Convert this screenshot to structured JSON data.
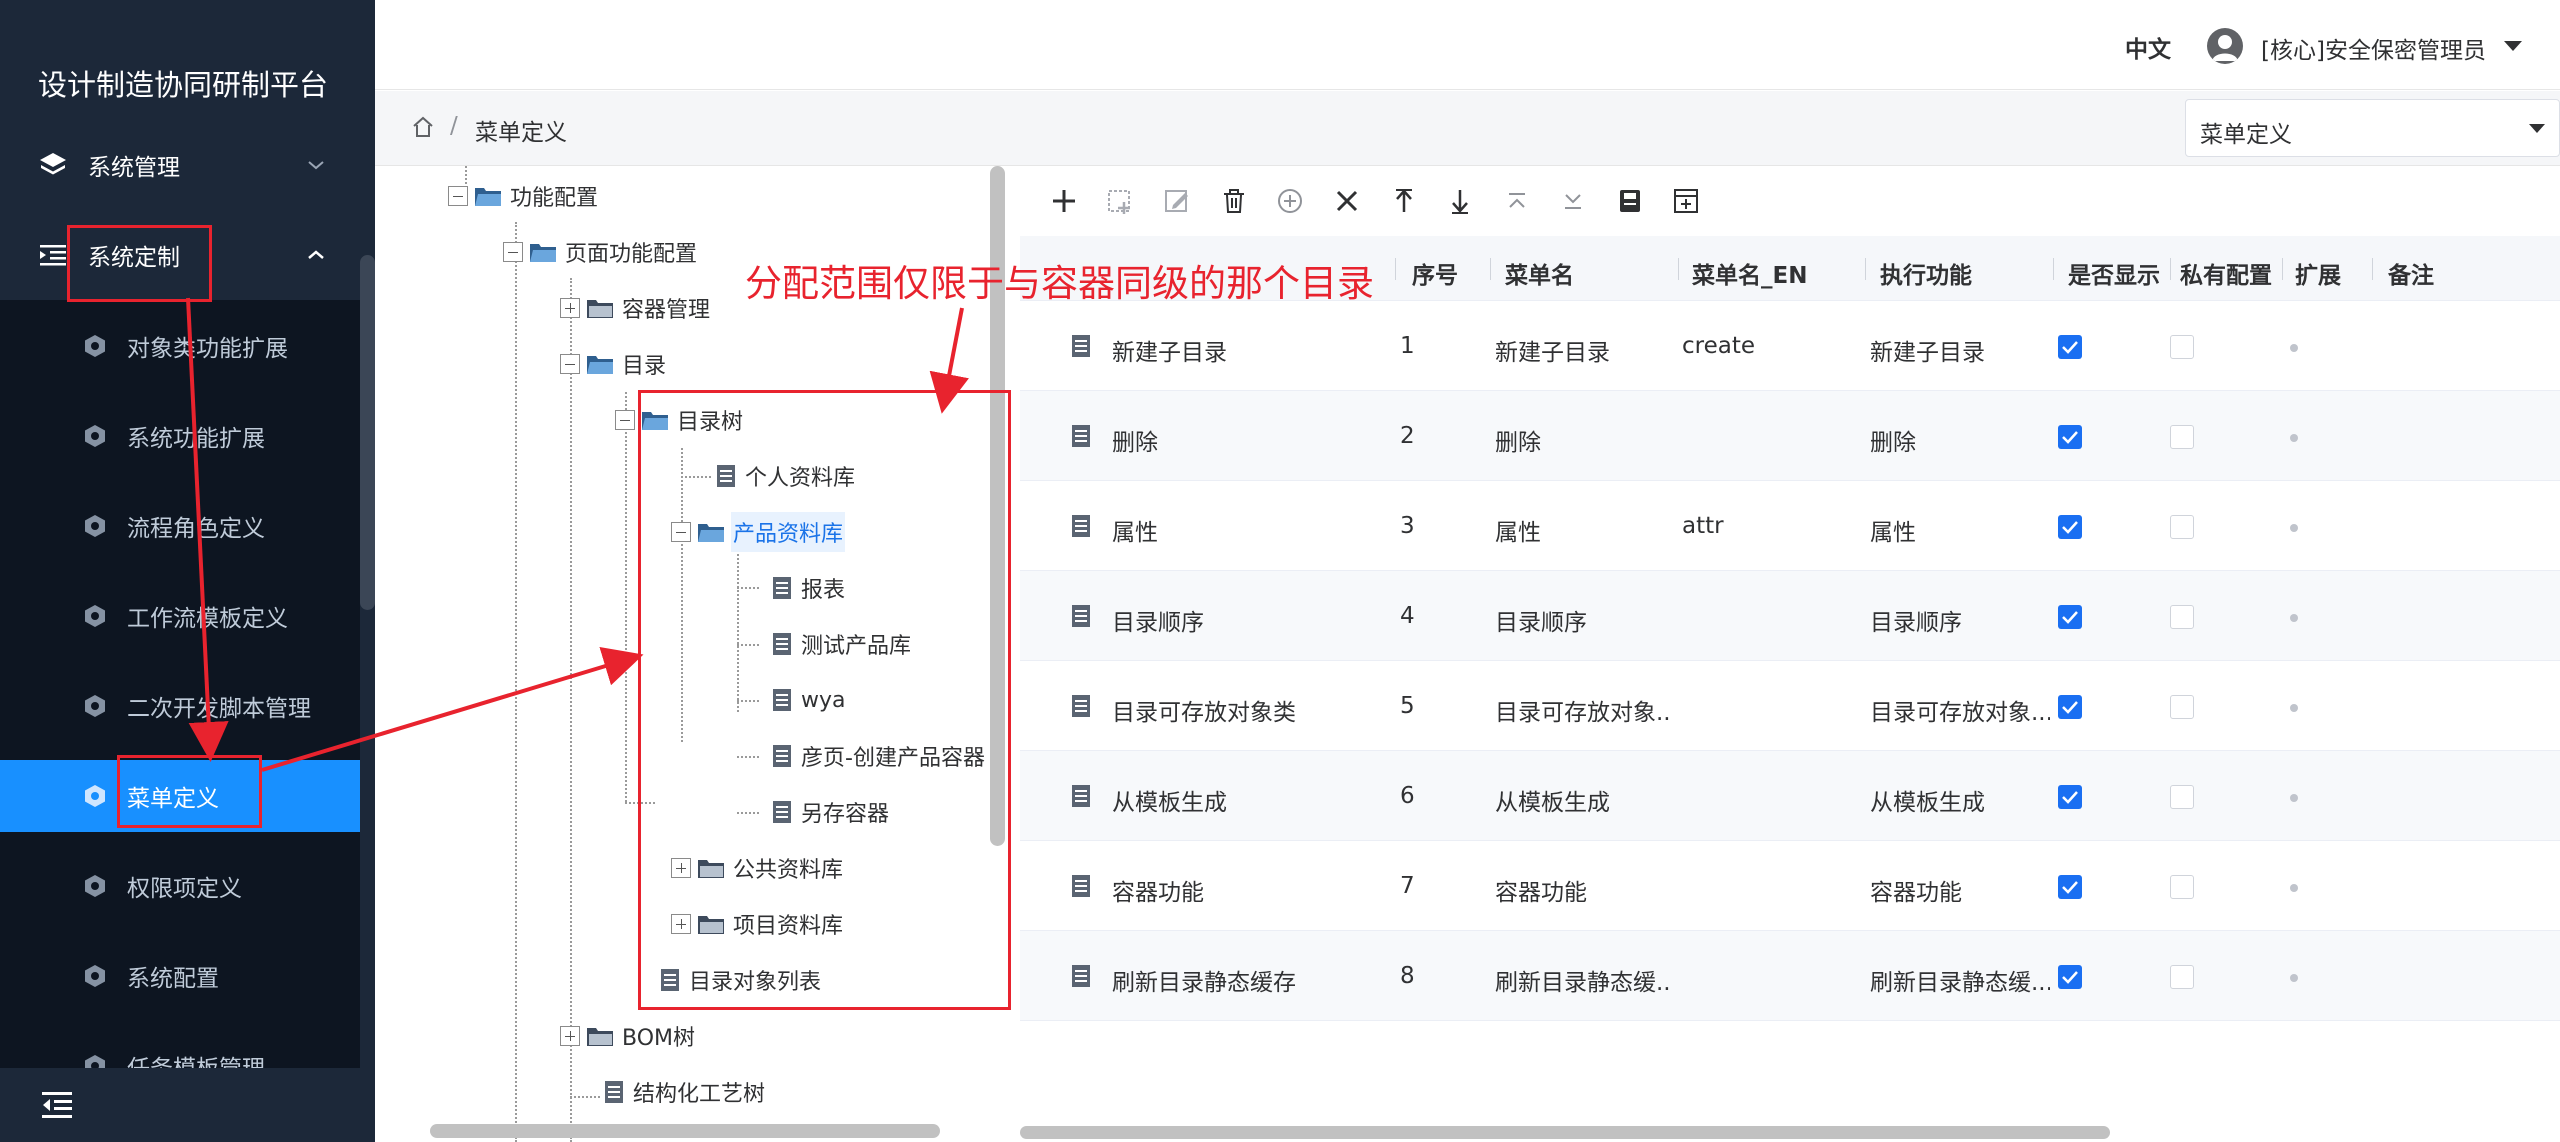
{
  "app": {
    "title": "设计制造协同研制平台"
  },
  "sidebar": {
    "groups": [
      {
        "label": "系统管理"
      },
      {
        "label": "系统定制"
      }
    ],
    "items": [
      {
        "label": "对象类功能扩展"
      },
      {
        "label": "系统功能扩展"
      },
      {
        "label": "流程角色定义"
      },
      {
        "label": "工作流模板定义"
      },
      {
        "label": "二次开发脚本管理"
      },
      {
        "label": "菜单定义"
      },
      {
        "label": "权限项定义"
      },
      {
        "label": "系统配置"
      },
      {
        "label": "任务模板管理"
      }
    ],
    "active_item": "菜单定义"
  },
  "header": {
    "language": "中文",
    "user": "[核心]安全保密管理员"
  },
  "breadcrumb": {
    "separator": "/",
    "current": "菜单定义"
  },
  "menu_select": {
    "value": "菜单定义"
  },
  "tree": {
    "nodes": [
      {
        "label": "功能配置"
      },
      {
        "label": "页面功能配置"
      },
      {
        "label": "容器管理"
      },
      {
        "label": "目录"
      },
      {
        "label": "目录树"
      },
      {
        "label": "个人资料库"
      },
      {
        "label": "产品资料库"
      },
      {
        "label": "报表"
      },
      {
        "label": "测试产品库"
      },
      {
        "label": "wya"
      },
      {
        "label": "彦页-创建产品容器"
      },
      {
        "label": "另存容器"
      },
      {
        "label": "公共资料库"
      },
      {
        "label": "项目资料库"
      },
      {
        "label": "目录对象列表"
      },
      {
        "label": "BOM树"
      },
      {
        "label": "结构化工艺树"
      }
    ]
  },
  "toolbar": {
    "buttons": [
      {
        "icon": "plus-icon"
      },
      {
        "icon": "add-child-icon"
      },
      {
        "icon": "edit-icon"
      },
      {
        "icon": "delete-icon"
      },
      {
        "icon": "circle-plus-icon"
      },
      {
        "icon": "close-icon"
      },
      {
        "icon": "move-up-icon"
      },
      {
        "icon": "move-down-icon"
      },
      {
        "icon": "move-top-icon"
      },
      {
        "icon": "move-bottom-icon"
      },
      {
        "icon": "save-icon"
      },
      {
        "icon": "import-icon"
      }
    ]
  },
  "grid": {
    "columns": [
      "序号",
      "菜单名",
      "菜单名_EN",
      "执行功能",
      "是否显示",
      "私有配置",
      "扩展",
      "备注"
    ],
    "rows": [
      {
        "name": "新建子目录",
        "seq": "1",
        "menu": "新建子目录",
        "en": "create",
        "func": "新建子目录",
        "show": true
      },
      {
        "name": "删除",
        "seq": "2",
        "menu": "删除",
        "en": "",
        "func": "删除",
        "show": true
      },
      {
        "name": "属性",
        "seq": "3",
        "menu": "属性",
        "en": "attr",
        "func": "属性",
        "show": true
      },
      {
        "name": "目录顺序",
        "seq": "4",
        "menu": "目录顺序",
        "en": "",
        "func": "目录顺序",
        "show": true
      },
      {
        "name": "目录可存放对象类",
        "seq": "5",
        "menu": "目录可存放对象...",
        "en": "",
        "func": "目录可存放对象...",
        "show": true
      },
      {
        "name": "从模板生成",
        "seq": "6",
        "menu": "从模板生成",
        "en": "",
        "func": "从模板生成",
        "show": true
      },
      {
        "name": "容器功能",
        "seq": "7",
        "menu": "容器功能",
        "en": "",
        "func": "容器功能",
        "show": true
      },
      {
        "name": "刷新目录静态缓存",
        "seq": "8",
        "menu": "刷新目录静态缓...",
        "en": "",
        "func": "刷新目录静态缓...",
        "show": true
      }
    ]
  },
  "annotation": {
    "text": "分配范围仅限于与容器同级的那个目录",
    "color": "#e8232e"
  },
  "colors": {
    "sidebar_bg": "#1c2839",
    "submenu_bg": "#0d1521",
    "accent": "#1890ff",
    "checkbox": "#1a6ff2"
  }
}
